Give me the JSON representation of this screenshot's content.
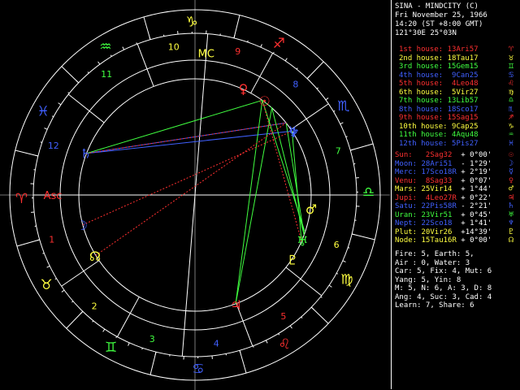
{
  "header": {
    "name": "SINA - MINDCITY (C)",
    "date": "Fri November 25, 1966",
    "time": "14:20 (ST +8:00 GMT)",
    "location": "121°30E 25°03N"
  },
  "houses": [
    {
      "label": "1st house:",
      "pos": "13Ari57",
      "color": "#ff3030"
    },
    {
      "label": "2nd house:",
      "pos": "18Tau17",
      "color": "#ffff40"
    },
    {
      "label": "3rd house:",
      "pos": "15Gem15",
      "color": "#40ff40"
    },
    {
      "label": "4th house:",
      "pos": " 9Can25",
      "color": "#4060ff"
    },
    {
      "label": "5th house:",
      "pos": " 4Leo48",
      "color": "#ff3030"
    },
    {
      "label": "6th house:",
      "pos": " 5Vir27",
      "color": "#ffff40"
    },
    {
      "label": "7th house:",
      "pos": "13Lib57",
      "color": "#40ff40"
    },
    {
      "label": "8th house:",
      "pos": "18Sco17",
      "color": "#4060ff"
    },
    {
      "label": "9th house:",
      "pos": "15Sag15",
      "color": "#ff3030"
    },
    {
      "label": "10th house:",
      "pos": " 9Cap25",
      "color": "#ffff40"
    },
    {
      "label": "11th house:",
      "pos": " 4Aqu48",
      "color": "#40ff40"
    },
    {
      "label": "12th house:",
      "pos": " 5Pis27",
      "color": "#4060ff"
    }
  ],
  "house_glyphs": [
    "♈",
    "♉",
    "♊",
    "♋",
    "♌",
    "♍",
    "♎",
    "♏",
    "♐",
    "♑",
    "♒",
    "♓"
  ],
  "planets": [
    {
      "label": "Sun:",
      "pos": " 2Sag32",
      "speed": " + 0°00'",
      "color": "#ff3030",
      "glyph": "☉"
    },
    {
      "label": "Moon:",
      "pos": "28Ari51",
      "speed": " - 1°29'",
      "color": "#4060ff",
      "glyph": "☽"
    },
    {
      "label": "Merc:",
      "pos": "17Sco18R",
      "speed": " + 2°19'",
      "color": "#4060ff",
      "glyph": "☿"
    },
    {
      "label": "Venu:",
      "pos": " 8Sag33",
      "speed": " + 0°07'",
      "color": "#ff3030",
      "glyph": "♀"
    },
    {
      "label": "Mars:",
      "pos": "25Vir14",
      "speed": " + 1°44'",
      "color": "#ffff40",
      "glyph": "♂"
    },
    {
      "label": "Jupi:",
      "pos": " 4Leo27R",
      "speed": " + 0°22'",
      "color": "#ff3030",
      "glyph": "♃"
    },
    {
      "label": "Satu:",
      "pos": "22Pis58R",
      "speed": " - 2°21'",
      "color": "#4060ff",
      "glyph": "♄"
    },
    {
      "label": "Uran:",
      "pos": "23Vir51",
      "speed": " + 0°45'",
      "color": "#40ff40",
      "glyph": "♅"
    },
    {
      "label": "Nept:",
      "pos": "22Sco18",
      "speed": " + 1°41'",
      "color": "#4060ff",
      "glyph": "♆"
    },
    {
      "label": "Plut:",
      "pos": "20Vir26",
      "speed": " +14°39'",
      "color": "#ffff40",
      "glyph": "♇"
    },
    {
      "label": "Node:",
      "pos": "15Tau16R",
      "speed": " + 0°00'",
      "color": "#ffff40",
      "glyph": "☊"
    }
  ],
  "stats": [
    "Fire: 5, Earth: 5,",
    "Air : 0, Water: 3",
    "Car: 5, Fix: 4, Mut: 6",
    "Yang: 5, Yin: 8",
    "M: 5, N: 6, A: 3, D: 8",
    "Ang: 4, Suc: 3, Cad: 4",
    "Learn: 7, Share: 6"
  ],
  "wheel": {
    "asc_label": "Asc",
    "mc_label": "MC",
    "sign_glyphs": [
      {
        "g": "♈",
        "c": "#ff3030"
      },
      {
        "g": "♉",
        "c": "#ffff40"
      },
      {
        "g": "♊",
        "c": "#40ff40"
      },
      {
        "g": "♋",
        "c": "#4060ff"
      },
      {
        "g": "♌",
        "c": "#ff3030"
      },
      {
        "g": "♍",
        "c": "#ffff40"
      },
      {
        "g": "♎",
        "c": "#40ff40"
      },
      {
        "g": "♏",
        "c": "#4060ff"
      },
      {
        "g": "♐",
        "c": "#ff3030"
      },
      {
        "g": "♑",
        "c": "#ffff40"
      },
      {
        "g": "♒",
        "c": "#40ff40"
      },
      {
        "g": "♓",
        "c": "#4060ff"
      }
    ],
    "house_numbers": [
      {
        "n": "1",
        "c": "#ff3030"
      },
      {
        "n": "2",
        "c": "#ffff40"
      },
      {
        "n": "3",
        "c": "#40ff40"
      },
      {
        "n": "4",
        "c": "#4060ff"
      },
      {
        "n": "5",
        "c": "#ff3030"
      },
      {
        "n": "6",
        "c": "#ffff40"
      },
      {
        "n": "7",
        "c": "#40ff40"
      },
      {
        "n": "8",
        "c": "#4060ff"
      },
      {
        "n": "9",
        "c": "#ff3030"
      },
      {
        "n": "10",
        "c": "#ffff40"
      },
      {
        "n": "11",
        "c": "#40ff40"
      },
      {
        "n": "12",
        "c": "#4060ff"
      }
    ]
  }
}
